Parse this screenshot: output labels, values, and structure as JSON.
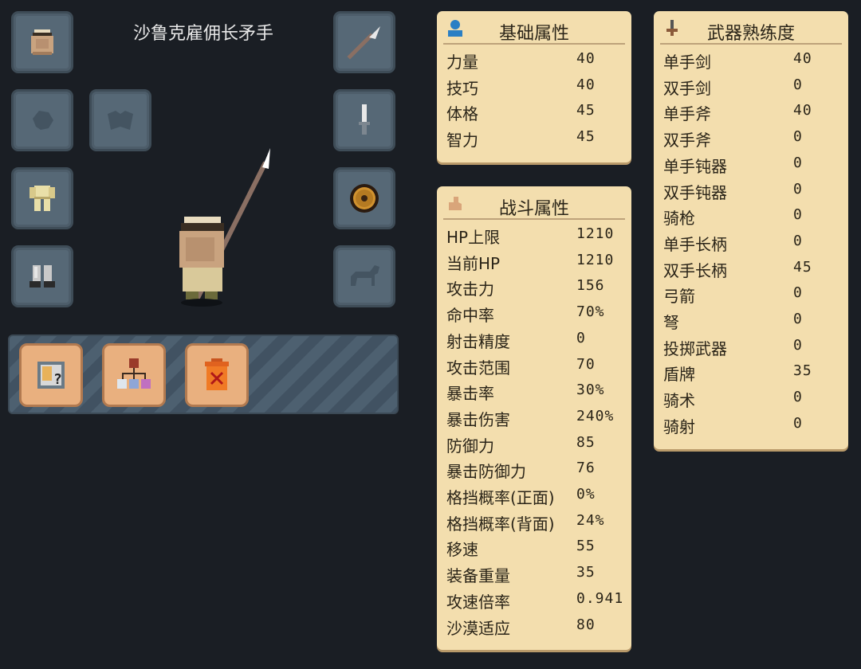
{
  "unit": {
    "name": "沙鲁克雇佣长矛手"
  },
  "basic": {
    "title": "基础属性",
    "icon": "person-icon",
    "rows": [
      {
        "label": "力量",
        "value": "40"
      },
      {
        "label": "技巧",
        "value": "40"
      },
      {
        "label": "体格",
        "value": "45"
      },
      {
        "label": "智力",
        "value": "45"
      }
    ]
  },
  "combat": {
    "title": "战斗属性",
    "icon": "arm-icon",
    "rows": [
      {
        "label": "HP上限",
        "value": "1210"
      },
      {
        "label": "当前HP",
        "value": "1210"
      },
      {
        "label": "攻击力",
        "value": "156"
      },
      {
        "label": "命中率",
        "value": "70%"
      },
      {
        "label": "射击精度",
        "value": "0"
      },
      {
        "label": "攻击范围",
        "value": "70"
      },
      {
        "label": "暴击率",
        "value": "30%"
      },
      {
        "label": "暴击伤害",
        "value": "240%"
      },
      {
        "label": "防御力",
        "value": "85"
      },
      {
        "label": "暴击防御力",
        "value": "76"
      },
      {
        "label": "格挡概率(正面)",
        "value": "0%"
      },
      {
        "label": "格挡概率(背面)",
        "value": "24%"
      },
      {
        "label": "移速",
        "value": "55"
      },
      {
        "label": "装备重量",
        "value": "35"
      },
      {
        "label": "攻速倍率",
        "value": "0.941"
      },
      {
        "label": "沙漠适应",
        "value": "80"
      }
    ]
  },
  "weapons": {
    "title": "武器熟练度",
    "icon": "sword-icon",
    "rows": [
      {
        "label": "单手剑",
        "value": "40"
      },
      {
        "label": "双手剑",
        "value": "0"
      },
      {
        "label": "单手斧",
        "value": "40"
      },
      {
        "label": "双手斧",
        "value": "0"
      },
      {
        "label": "单手钝器",
        "value": "0"
      },
      {
        "label": "双手钝器",
        "value": "0"
      },
      {
        "label": "骑枪",
        "value": "0"
      },
      {
        "label": "单手长柄",
        "value": "0"
      },
      {
        "label": "双手长柄",
        "value": "45"
      },
      {
        "label": "弓箭",
        "value": "0"
      },
      {
        "label": "弩",
        "value": "0"
      },
      {
        "label": "投掷武器",
        "value": "0"
      },
      {
        "label": "盾牌",
        "value": "35"
      },
      {
        "label": "骑术",
        "value": "0"
      },
      {
        "label": "骑射",
        "value": "0"
      }
    ]
  },
  "colors": {
    "panel": "#f3deae",
    "slot": "#566876",
    "button": "#e9b07f",
    "background": "#1a1e24"
  }
}
